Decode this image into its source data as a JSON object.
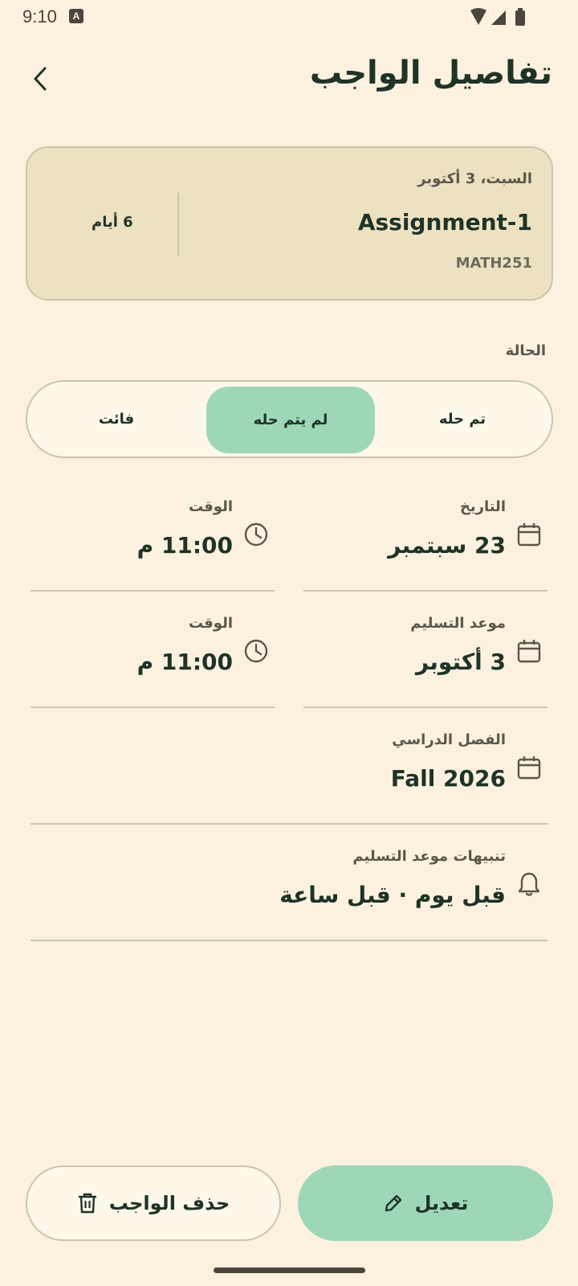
{
  "status_bar": {
    "time": "9:10",
    "notification_badge": "A"
  },
  "header": {
    "title": "تفاصيل الواجب"
  },
  "summary": {
    "date": "السبت، 3 أكتوبر",
    "assignment": "Assignment-1",
    "course": "MATH251",
    "days_left": "6 أيام"
  },
  "status": {
    "label": "الحالة",
    "options": [
      "تم حله",
      "لم يتم حله",
      "فائت"
    ],
    "selected": "لم يتم حله"
  },
  "fields": {
    "date": {
      "label": "التاريخ",
      "value": "23 سبتمبر",
      "icon": "calendar-icon"
    },
    "date_time": {
      "label": "الوقت",
      "value": "11:00 م",
      "icon": "clock-icon"
    },
    "due": {
      "label": "موعد التسليم",
      "value": "3 أكتوبر",
      "icon": "calendar-icon"
    },
    "due_time": {
      "label": "الوقت",
      "value": "11:00 م",
      "icon": "clock-icon"
    },
    "semester": {
      "label": "الفصل الدراسي",
      "value": "Fall 2026",
      "icon": "calendar-icon"
    },
    "reminders": {
      "label": "تنبيهات موعد التسليم",
      "value": "قبل يوم · قبل ساعة",
      "icon": "bell-icon"
    }
  },
  "actions": {
    "edit": "تعديل",
    "delete": "حذف الواجب"
  },
  "colors": {
    "background": "#fbf1de",
    "accent": "#9dd7b7",
    "card": "#ece2c1",
    "text": "#1f3327"
  }
}
